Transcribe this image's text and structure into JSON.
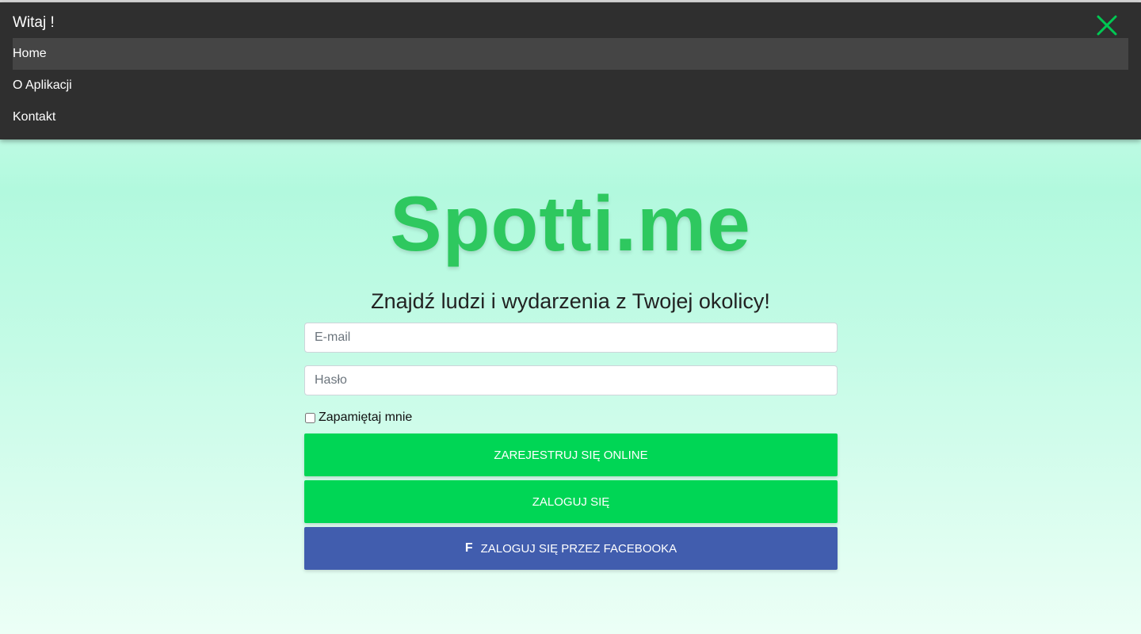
{
  "menu": {
    "title": "Witaj !",
    "items": [
      {
        "label": "Home"
      },
      {
        "label": "O Aplikacji"
      },
      {
        "label": "Kontakt"
      }
    ],
    "close_icon": "close-icon",
    "accent_color": "#00c853"
  },
  "hero": {
    "logo": "Spotti.me",
    "tagline": "Znajdź ludzi i wydarzenia z Twojej okolicy!"
  },
  "form": {
    "email_placeholder": "E-mail",
    "password_placeholder": "Hasło",
    "remember_label": "Zapamiętaj mnie",
    "remember_checked": false,
    "register_label": "ZAREJESTRUJ SIĘ ONLINE",
    "login_label": "ZALOGUJ SIĘ",
    "facebook_label": "ZALOGUJ SIĘ PRZEZ FACEBOOKA",
    "facebook_icon": "facebook-icon"
  },
  "colors": {
    "brand_green": "#2ec85f",
    "button_green": "#00d655",
    "facebook_blue": "#415dae",
    "menu_bg": "#2f2f2f"
  }
}
